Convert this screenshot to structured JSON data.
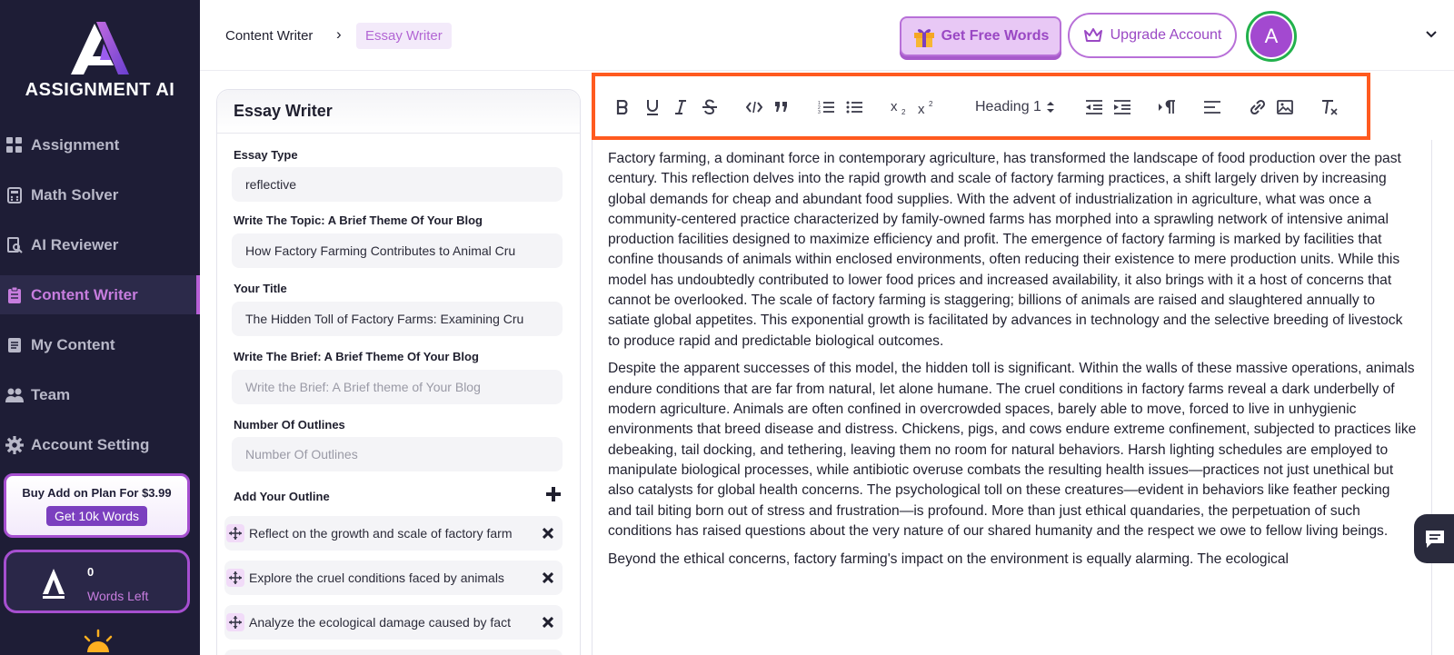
{
  "brand": {
    "name": "ASSIGNMENT AI"
  },
  "sidebar": {
    "items": [
      {
        "label": "Assignment",
        "icon": "grid-icon",
        "active": false
      },
      {
        "label": "Math Solver",
        "icon": "calculator-icon",
        "active": false
      },
      {
        "label": "AI Reviewer",
        "icon": "document-search-icon",
        "active": false
      },
      {
        "label": "Content Writer",
        "icon": "clipboard-icon",
        "active": true
      },
      {
        "label": "My Content",
        "icon": "document-icon",
        "active": false
      },
      {
        "label": "Team",
        "icon": "team-icon",
        "active": false
      },
      {
        "label": "Account Setting",
        "icon": "gear-icon",
        "active": false
      }
    ],
    "promo": {
      "text": "Buy Add on Plan For $3.99",
      "button": "Get 10k Words"
    },
    "words": {
      "count": "0",
      "label": "Words Left"
    }
  },
  "header": {
    "breadcrumb": [
      "Content Writer",
      "Essay Writer"
    ],
    "free_words": "Get Free Words",
    "upgrade": "Upgrade Account",
    "avatar_letter": "A"
  },
  "form": {
    "title": "Essay Writer",
    "fields": [
      {
        "label": "Essay Type",
        "value": "reflective",
        "placeholder": ""
      },
      {
        "label": "Write The Topic: A Brief Theme Of Your Blog",
        "value": "How Factory Farming Contributes to Animal Cru",
        "placeholder": ""
      },
      {
        "label": "Your Title",
        "value": "The Hidden Toll of Factory Farms: Examining Cru",
        "placeholder": ""
      },
      {
        "label": "Write The Brief: A Brief Theme Of Your Blog",
        "value": "",
        "placeholder": "Write the Brief: A Brief theme of Your Blog"
      },
      {
        "label": "Number Of Outlines",
        "value": "",
        "placeholder": "Number Of Outlines"
      }
    ],
    "outline_label": "Add Your Outline",
    "outlines": [
      "Reflect on the growth and scale of factory farm",
      "Explore the cruel conditions faced by animals",
      "Analyze the ecological damage caused by fact"
    ]
  },
  "editor": {
    "heading_select": "Heading 1",
    "paragraphs": [
      "Factory farming, a dominant force in contemporary agriculture, has transformed the landscape of food production over the past century. This reflection delves into the rapid growth and scale of factory farming practices, a shift largely driven by increasing global demands for cheap and abundant food supplies. With the advent of industrialization in agriculture, what was once a community-centered practice characterized by family-owned farms has morphed into a sprawling network of intensive animal production facilities designed to maximize efficiency and profit. The emergence of factory farming is marked by facilities that confine thousands of animals within enclosed environments, often reducing their existence to mere production units. While this model has undoubtedly contributed to lower food prices and increased availability, it also brings with it a host of concerns that cannot be overlooked. The scale of factory farming is staggering; billions of animals are raised and slaughtered annually to satiate global appetites. This exponential growth is facilitated by advances in technology and the selective breeding of livestock to produce rapid and predictable biological outcomes.",
      "Despite the apparent successes of this model, the hidden toll is significant. Within the walls of these massive operations, animals endure conditions that are far from natural, let alone humane. The cruel conditions in factory farms reveal a dark underbelly of modern agriculture. Animals are often confined in overcrowded spaces, barely able to move, forced to live in unhygienic environments that breed disease and distress. Chickens, pigs, and cows endure extreme confinement, subjected to practices like debeaking, tail docking, and tethering, leaving them no room for natural behaviors. Harsh lighting schedules are employed to manipulate biological processes, while antibiotic overuse combats the resulting health issues—practices not just unethical but also catalysts for global health concerns. The psychological toll on these creatures—evident in behaviors like feather pecking and tail biting born out of stress and frustration—is profound. More than just ethical quandaries, the perpetuation of such conditions has raised questions about the very nature of our shared humanity and the respect we owe to fellow living beings.",
      "Beyond the ethical concerns, factory farming's impact on the environment is equally alarming. The ecological"
    ]
  },
  "colors": {
    "accent": "#a64fd0",
    "sidebar_bg": "#1e1d36",
    "highlight": "#ff5a1f",
    "avatar_ring": "#22b14c"
  }
}
